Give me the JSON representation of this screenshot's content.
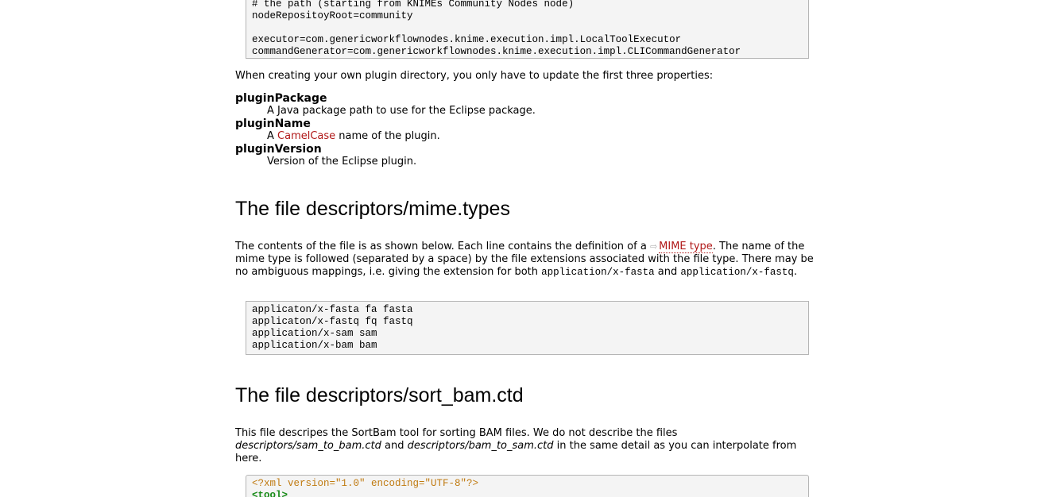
{
  "code_block_1": {
    "lines": "# the path (starting from KNIMEs Community Nodes node)\nnodeRepositoyRoot=community\n\nexecutor=com.genericworkflownodes.knime.execution.impl.LocalToolExecutor\ncommandGenerator=com.genericworkflownodes.knime.execution.impl.CLICommandGenerator"
  },
  "intro_text": "When creating your own plugin directory, you only have to update the first three properties:",
  "properties": [
    {
      "term": "pluginPackage",
      "desc": "A Java package path to use for the Eclipse package."
    },
    {
      "term": "pluginName",
      "desc_before": "A ",
      "link": "CamelCase",
      "desc_after": " name of the plugin."
    },
    {
      "term": "pluginVersion",
      "desc": "Version of the Eclipse plugin."
    }
  ],
  "section_mime": {
    "heading": "The file descriptors/mime.types",
    "para_part1": "The contents of the file is as shown below. Each line contains the definition of a ",
    "ext_icon": "external-link-icon",
    "link": "MIME type",
    "para_part2": ". The name of the mime type is followed (separated by a space) by the file extensions associated with the file type. There may be no ambiguous mappings, i.e. giving the extension for both ",
    "code1": "application/x-fasta",
    "para_part3": " and ",
    "code2": "application/x-fastq",
    "para_part4": ".",
    "code_block": "applicaton/x-fasta fa fasta\napplicaton/x-fastq fq fastq\napplication/x-sam sam\napplication/x-bam bam"
  },
  "section_sortbam": {
    "heading": "The file descriptors/sort_bam.ctd",
    "para_part1": "This file descripes the SortBam tool for sorting BAM files. We do not describe the files ",
    "em1": "descriptors/sam_to_bam.ctd",
    "para_part2": " and ",
    "em2": "descriptors/bam_to_sam.ctd",
    "para_part3": " in the same detail as you can interpolate from here.",
    "xml_decl": "<?xml version=\"1.0\" encoding=\"UTF-8\"?>",
    "xml_tag": "<tool>"
  },
  "colors": {
    "link": "#b01818",
    "code_bg": "#f4f4f4",
    "code_border": "#b5b5b5",
    "xml_decl": "#c07a10",
    "xml_tag": "#188b18"
  }
}
